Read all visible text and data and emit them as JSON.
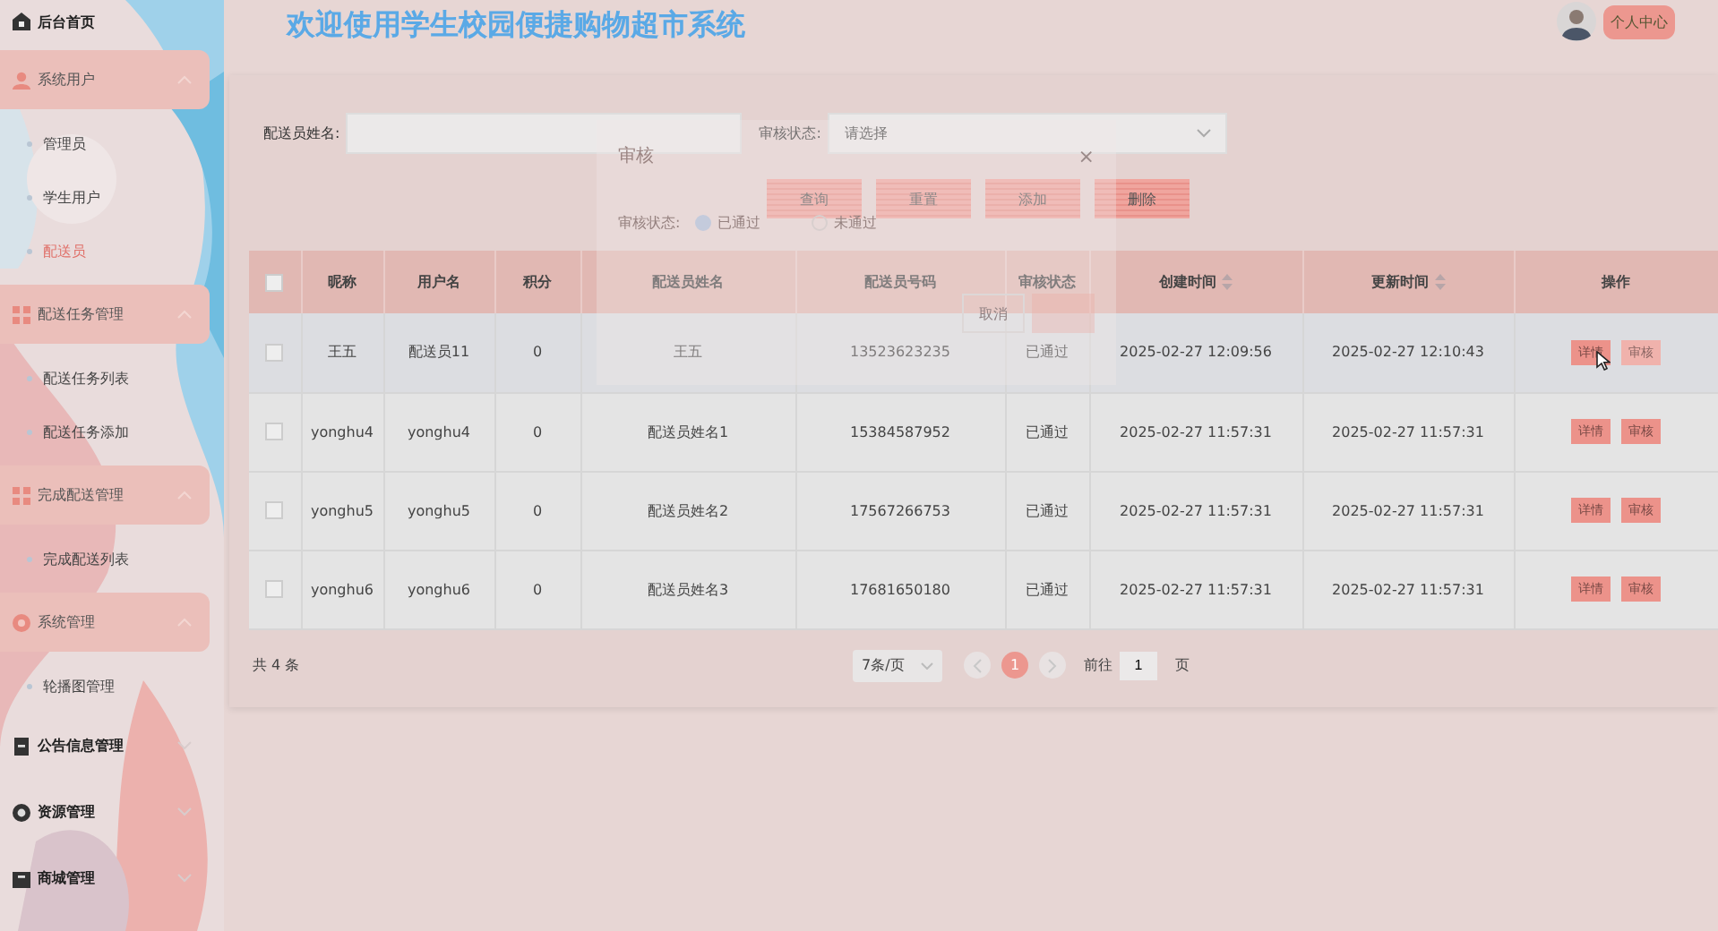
{
  "header": {
    "title": "欢迎使用学生校园便捷购物超市系统",
    "user_button": "个人中心"
  },
  "sidebar": {
    "items": [
      {
        "kind": "link",
        "label": "后台首页"
      },
      {
        "kind": "group",
        "label": "系统用户",
        "expanded": true,
        "children": [
          {
            "label": "管理员",
            "selected": false
          },
          {
            "label": "学生用户",
            "selected": false
          },
          {
            "label": "配送员",
            "selected": true
          }
        ]
      },
      {
        "kind": "group",
        "label": "配送任务管理",
        "expanded": true,
        "children": [
          {
            "label": "配送任务列表",
            "selected": false
          },
          {
            "label": "配送任务添加",
            "selected": false
          }
        ]
      },
      {
        "kind": "group",
        "label": "完成配送管理",
        "expanded": true,
        "children": [
          {
            "label": "完成配送列表",
            "selected": false
          }
        ]
      },
      {
        "kind": "group",
        "label": "系统管理",
        "expanded": true,
        "children": [
          {
            "label": "轮播图管理",
            "selected": false
          }
        ]
      },
      {
        "kind": "group",
        "label": "公告信息管理",
        "expanded": false
      },
      {
        "kind": "group",
        "label": "资源管理",
        "expanded": false
      },
      {
        "kind": "group",
        "label": "商城管理",
        "expanded": false
      }
    ]
  },
  "search": {
    "fields": [
      {
        "label": "配送员姓名:",
        "kind": "input"
      },
      {
        "label": "审核状态:",
        "kind": "select",
        "placeholder": "请选择"
      }
    ],
    "buttons": [
      "查询",
      "重置",
      "添加",
      "删除"
    ]
  },
  "dialog": {
    "title": "审核",
    "close": "×",
    "field_label": "审核状态:",
    "options": [
      {
        "label": "已通过",
        "selected": true
      },
      {
        "label": "未通过",
        "selected": false
      }
    ],
    "cancel": "取消"
  },
  "table": {
    "all_checked": false,
    "columns": [
      {
        "label": "昵称",
        "sortable": false
      },
      {
        "label": "用户名",
        "sortable": false
      },
      {
        "label": "积分",
        "sortable": false
      },
      {
        "label": "配送员姓名",
        "sortable": false
      },
      {
        "label": "配送员号码",
        "sortable": false
      },
      {
        "label": "审核状态",
        "sortable": false
      },
      {
        "label": "创建时间",
        "sortable": true
      },
      {
        "label": "更新时间",
        "sortable": true
      },
      {
        "label": "操作",
        "sortable": false
      }
    ],
    "rows": [
      {
        "highlighted": true,
        "checked": false,
        "cells": [
          "王五",
          "配送员11",
          "0",
          "王五",
          "13523623235",
          "已通过",
          "2025-02-27 12:09:56",
          "2025-02-27 12:10:43"
        ],
        "actions": [
          {
            "label": "详情",
            "disabled": false
          },
          {
            "label": "审核",
            "disabled": true
          }
        ]
      },
      {
        "highlighted": false,
        "checked": false,
        "cells": [
          "yonghu4",
          "yonghu4",
          "0",
          "配送员姓名1",
          "15384587952",
          "已通过",
          "2025-02-27 11:57:31",
          "2025-02-27 11:57:31"
        ],
        "actions": [
          {
            "label": "详情",
            "disabled": false
          },
          {
            "label": "审核",
            "disabled": false
          }
        ]
      },
      {
        "highlighted": false,
        "checked": false,
        "cells": [
          "yonghu5",
          "yonghu5",
          "0",
          "配送员姓名2",
          "17567266753",
          "已通过",
          "2025-02-27 11:57:31",
          "2025-02-27 11:57:31"
        ],
        "actions": [
          {
            "label": "详情",
            "disabled": false
          },
          {
            "label": "审核",
            "disabled": false
          }
        ]
      },
      {
        "highlighted": false,
        "checked": false,
        "cells": [
          "yonghu6",
          "yonghu6",
          "0",
          "配送员姓名3",
          "17681650180",
          "已通过",
          "2025-02-27 11:57:31",
          "2025-02-27 11:57:31"
        ],
        "actions": [
          {
            "label": "详情",
            "disabled": false
          },
          {
            "label": "审核",
            "disabled": false
          }
        ]
      }
    ]
  },
  "pagination": {
    "total": "共 4 条",
    "page_size": "7条/页",
    "pages": [
      {
        "label": "1",
        "selected": true
      }
    ],
    "goto_label": "前往",
    "goto_value": "1",
    "goto_suffix": "页"
  }
}
